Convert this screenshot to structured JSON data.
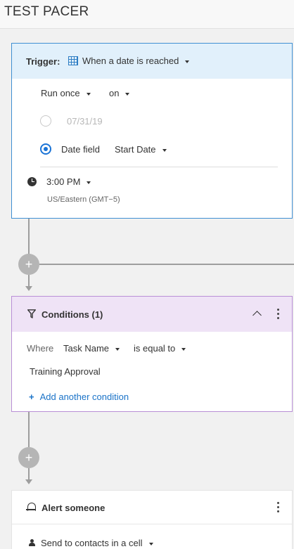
{
  "header": {
    "title": "TEST PACER"
  },
  "trigger": {
    "label": "Trigger:",
    "type": "When a date is reached",
    "frequency": "Run once",
    "on_label": "on",
    "fixed_date": "07/31/19",
    "date_field_label": "Date field",
    "date_field_value": "Start Date",
    "time": "3:00 PM",
    "timezone": "US/Eastern (GMT−5)"
  },
  "conditions": {
    "title": "Conditions (1)",
    "where_label": "Where",
    "field": "Task Name",
    "operator": "is equal to",
    "value": "Training Approval",
    "add_label": "Add another condition"
  },
  "alert": {
    "title": "Alert someone",
    "recipient": "Send to contacts in a cell"
  },
  "icons": {
    "plus": "+",
    "add_condition_plus": "+"
  }
}
